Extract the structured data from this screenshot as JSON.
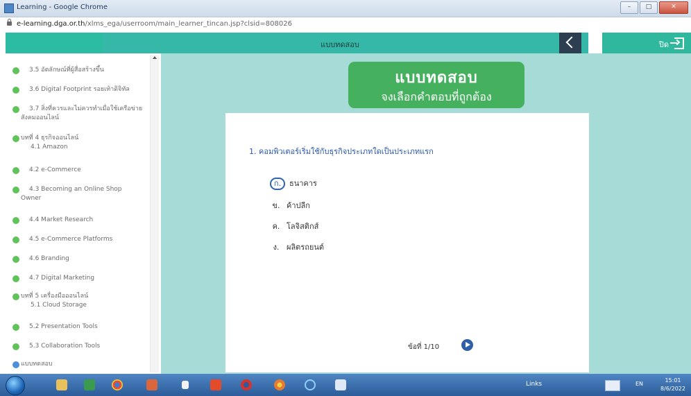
{
  "window": {
    "title": "Learning - Google Chrome",
    "url_domain": "e-learning.dga.or.th",
    "url_path": "/xlms_ega/userroom/main_learner_tincan.jsp?clsid=808026",
    "controls": {
      "minimize": "–",
      "maximize": "□",
      "close": "✕"
    }
  },
  "header": {
    "title": "แบบทดสอบ",
    "close_label": "ปิด"
  },
  "sidebar": {
    "items": [
      {
        "label": "3.5 อัตลักษณ์ที่ผู้สื่อสร้างขึ้น",
        "sub": "",
        "color": "#62c25a"
      },
      {
        "label": "3.6 Digital Footprint รอยเท้าดิจิทัล",
        "sub": "",
        "color": "#62c25a"
      },
      {
        "label": "3.7 สิ่งที่ควรและไม่ควรทำเมื่อใช้เครือข่ายสังคมออนไลน์",
        "sub": "",
        "color": "#62c25a"
      },
      {
        "label": "บทที่ 4 ธุรกิจออนไลน์",
        "sub": "4.1 Amazon",
        "color": "#62c25a"
      },
      {
        "label": "4.2 e-Commerce",
        "sub": "",
        "color": "#62c25a"
      },
      {
        "label": "4.3 Becoming an Online Shop Owner",
        "sub": "",
        "color": "#62c25a"
      },
      {
        "label": "4.4 Market Research",
        "sub": "",
        "color": "#62c25a"
      },
      {
        "label": "4.5 e-Commerce Platforms",
        "sub": "",
        "color": "#62c25a"
      },
      {
        "label": "4.6 Branding",
        "sub": "",
        "color": "#62c25a"
      },
      {
        "label": "4.7 Digital Marketing",
        "sub": "",
        "color": "#62c25a"
      },
      {
        "label": "บทที่ 5 เครื่องมือออนไลน์",
        "sub": "5.1 Cloud Storage",
        "color": "#62c25a"
      },
      {
        "label": "5.2 Presentation Tools",
        "sub": "",
        "color": "#62c25a"
      },
      {
        "label": "5.3 Collaboration Tools",
        "sub": "",
        "color": "#62c25a"
      },
      {
        "label": "แบบทดสอบ",
        "sub": "",
        "color": "#4f8fd6"
      }
    ]
  },
  "quiz": {
    "banner_title": "แบบทดสอบ",
    "banner_subtitle": "จงเลือกคำตอบที่ถูกต้อง",
    "question": "1. คอมพิวเตอร์เริ่มใช้กับธุรกิจประเภทใดเป็นประเภทแรก",
    "options": [
      {
        "letter": "ก.",
        "text": "ธนาคาร",
        "selected": true
      },
      {
        "letter": "ข.",
        "text": "ค้าปลีก",
        "selected": false
      },
      {
        "letter": "ค.",
        "text": "โลจิสติกส์",
        "selected": false
      },
      {
        "letter": "ง.",
        "text": "ผลิตรถยนต์",
        "selected": false
      }
    ],
    "page_label": "ข้อที่ 1/10"
  },
  "taskbar": {
    "links_label": "Links",
    "language": "EN",
    "time": "15:01",
    "date": "8/6/2022",
    "apps": [
      "explorer",
      "excel",
      "chrome",
      "powerpoint",
      "app",
      "office",
      "opera",
      "chrome-alt",
      "internet-explorer",
      "word"
    ]
  }
}
